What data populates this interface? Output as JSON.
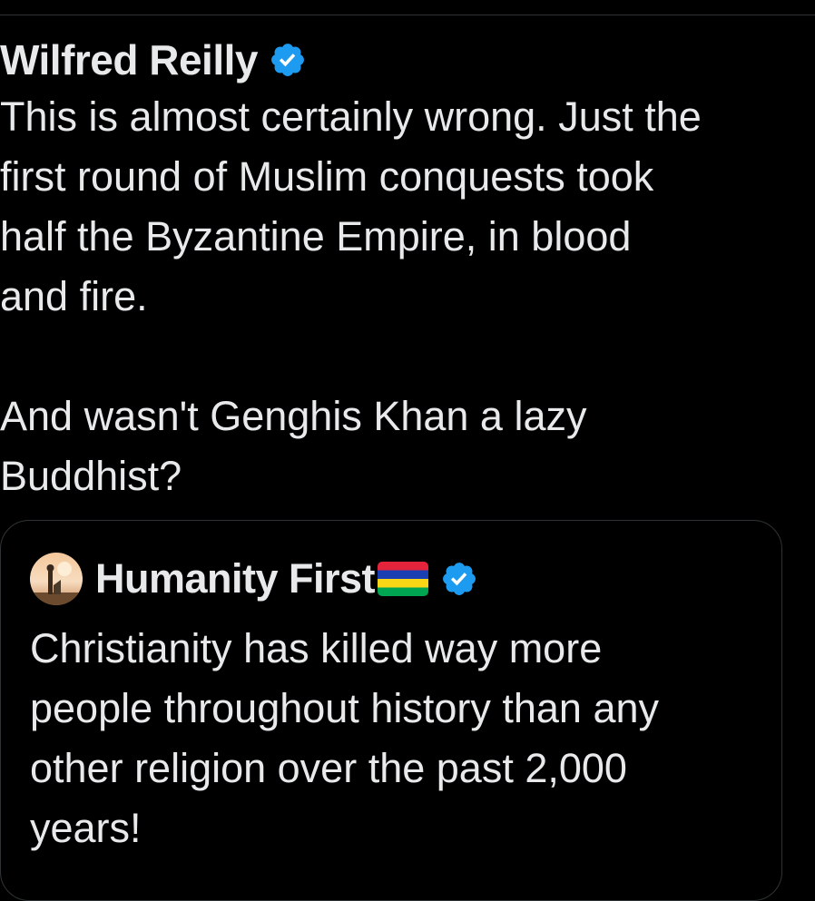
{
  "tweet": {
    "author_name": "Wilfred Reilly",
    "verified_icon": "verified-badge-icon",
    "text": "This is almost certainly wrong. Just the\nfirst round of Muslim conquests took\nhalf the Byzantine Empire, in blood\nand fire.\n\nAnd wasn't Genghis Khan a lazy\nBuddhist?"
  },
  "quoted_tweet": {
    "author_name": "Humanity First",
    "flag_icon": "mauritius-flag-icon",
    "verified_icon": "verified-badge-icon",
    "text": "Christianity has killed way more\npeople throughout history than any\nother religion over the past 2,000\nyears!"
  },
  "colors": {
    "background": "#000000",
    "text": "#e7e9ea",
    "verified_blue": "#1d9bf0",
    "border": "#2f3336"
  }
}
